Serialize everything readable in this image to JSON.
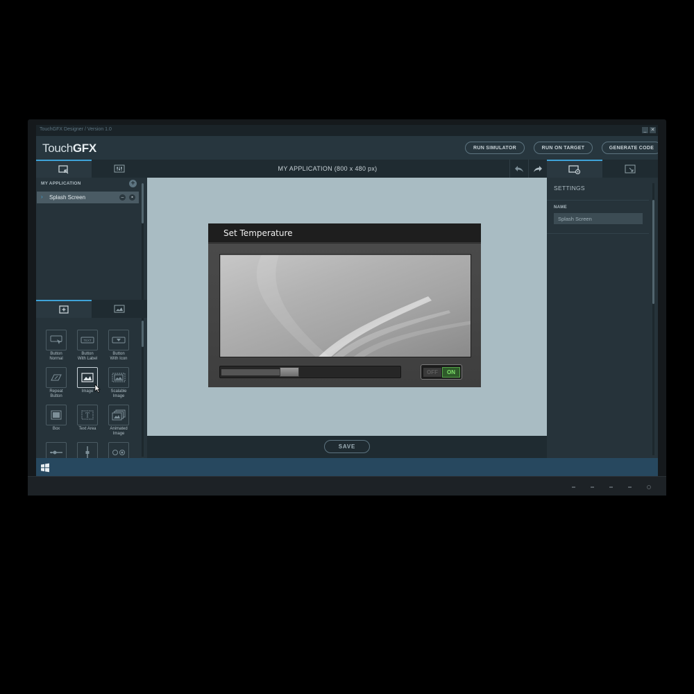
{
  "window": {
    "title": "TouchGFX Designer / Version 1.0",
    "minimize": "_",
    "close": "✕"
  },
  "header": {
    "logo_light": "Touch",
    "logo_bold": "GFX",
    "buttons": {
      "run_simulator": "RUN SIMULATOR",
      "run_on_target": "RUN ON TARGET",
      "generate_code": "GENERATE CODE"
    }
  },
  "left_panel": {
    "tabs": [
      {
        "icon": "select-screen-icon",
        "active": true
      },
      {
        "icon": "sliders-icon",
        "active": false
      }
    ],
    "section_title": "MY APPLICATION",
    "screens": [
      {
        "label": "Splash Screen",
        "selected": true
      }
    ],
    "widget_tabs": [
      {
        "icon": "add-widget-icon",
        "active": true
      },
      {
        "icon": "image-list-icon",
        "active": false
      }
    ],
    "widgets": [
      {
        "label": "Button\nNormal",
        "icon": "button-icon"
      },
      {
        "label": "Button\nWith Label",
        "icon": "text-button-icon"
      },
      {
        "label": "Button\nWith Icon",
        "icon": "icon-button-icon"
      },
      {
        "label": "Repeat\nButton",
        "icon": "repeat-button-icon"
      },
      {
        "label": "Image",
        "icon": "image-icon",
        "selected": true
      },
      {
        "label": "Scalable\nImage",
        "icon": "scalable-image-icon"
      },
      {
        "label": "Box",
        "icon": "box-icon"
      },
      {
        "label": "Text Area",
        "icon": "text-area-icon"
      },
      {
        "label": "Animated\nImage",
        "icon": "animated-image-icon"
      },
      {
        "label": "",
        "icon": "slider-icon"
      },
      {
        "label": "",
        "icon": "vertical-slider-icon"
      },
      {
        "label": "",
        "icon": "radio-button-icon"
      }
    ]
  },
  "center": {
    "title": "MY APPLICATION (800 x 480 px)",
    "undo": "↶",
    "redo": "↷",
    "save": "SAVE",
    "device": {
      "title": "Set Temperature",
      "slider_level": 0.33,
      "toggle_off": "OFF",
      "toggle_on": "ON",
      "toggle_state": "on"
    }
  },
  "right_panel": {
    "tabs": [
      {
        "icon": "screen-settings-icon",
        "active": true
      },
      {
        "icon": "transition-icon",
        "active": false
      }
    ],
    "settings_title": "SETTINGS",
    "name_label": "NAME",
    "name_value": "Splash Screen"
  },
  "taskbar": {
    "start_icon": "windows-start-icon"
  },
  "colors": {
    "accent": "#3fa3d8",
    "canvas": "#a9bcc3",
    "taskbar": "#27485f",
    "toggle_on": "#7fe06a"
  }
}
